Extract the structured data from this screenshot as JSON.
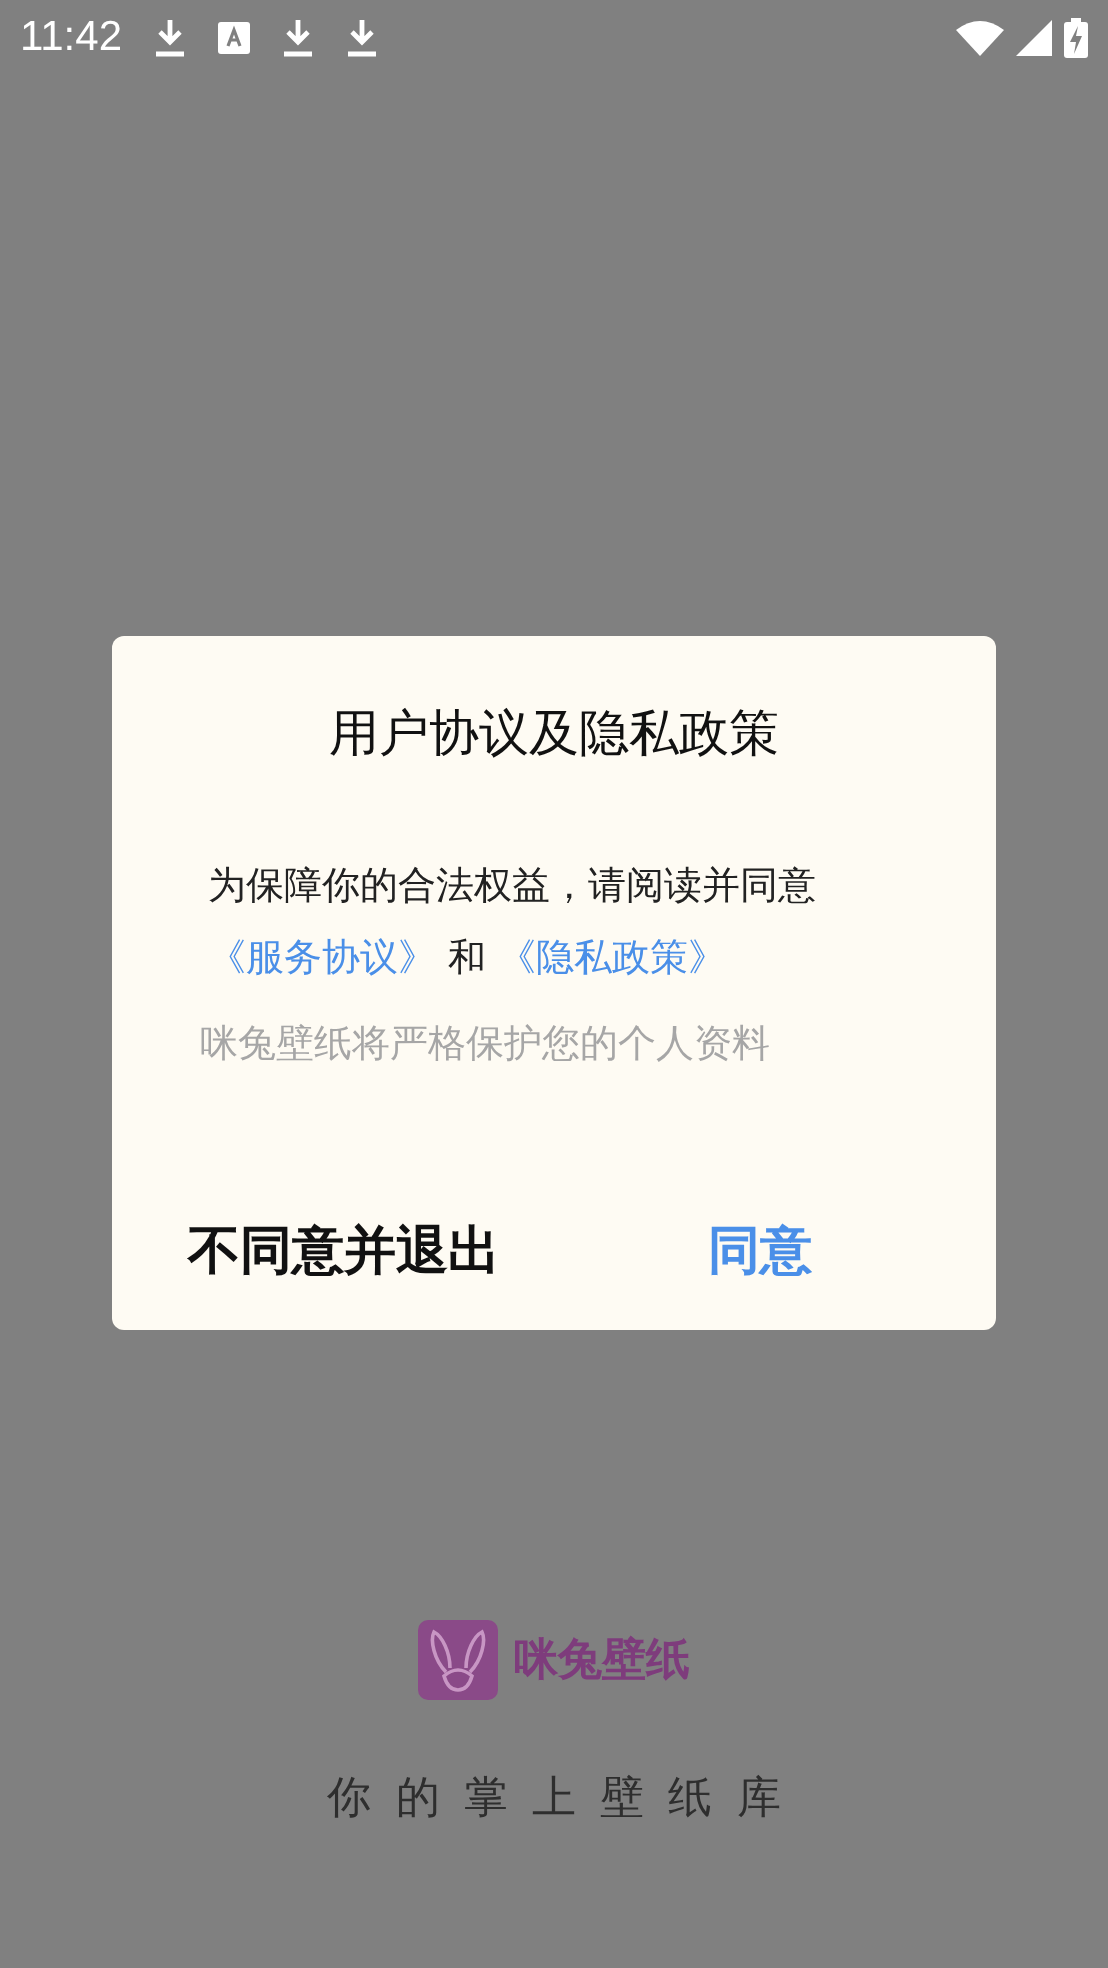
{
  "status_bar": {
    "time": "11:42"
  },
  "dialog": {
    "title": "用户协议及隐私政策",
    "message": "为保障你的合法权益，请阅读并同意",
    "links": [
      {
        "label": "《服务协议》"
      },
      {
        "label": "《隐私政策》"
      }
    ],
    "conjunction": "和",
    "note": "咪兔壁纸将严格保护您的个人资料",
    "buttons": [
      {
        "label": "不同意并退出",
        "kind": "decline"
      },
      {
        "label": "同意",
        "kind": "accept"
      }
    ]
  },
  "splash": {
    "logo_text": "咪兔壁纸",
    "tagline": "你的掌上壁纸库"
  }
}
